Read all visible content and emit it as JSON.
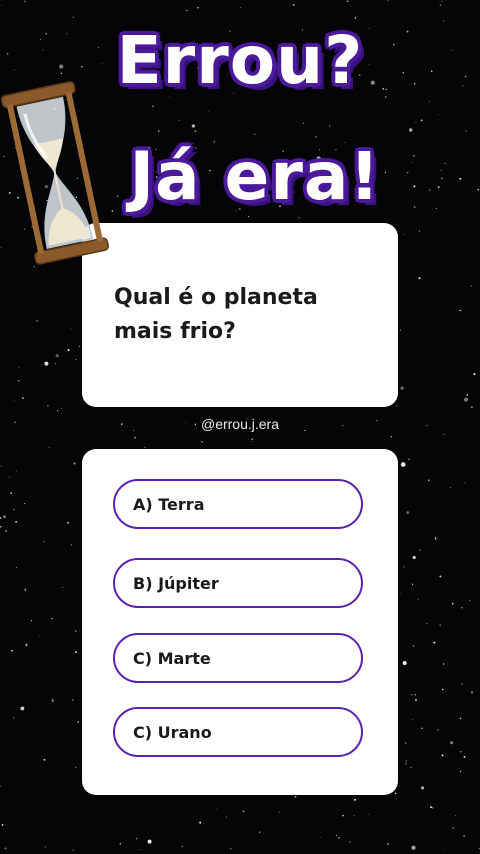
{
  "title": {
    "line1": "Errou?",
    "line2": "Já era!"
  },
  "question": {
    "text": "Qual é o planeta mais frio?"
  },
  "handle": "@errou.j.era",
  "options": [
    {
      "label": "A) Terra"
    },
    {
      "label": "B) Júpiter"
    },
    {
      "label": "C) Marte"
    },
    {
      "label": "C) Urano"
    }
  ],
  "colors": {
    "background": "#050508",
    "title_outline": "#4b1a9a",
    "option_border": "#5a22b0",
    "card": "#ffffff"
  },
  "icons": [
    "hourglass-icon"
  ]
}
